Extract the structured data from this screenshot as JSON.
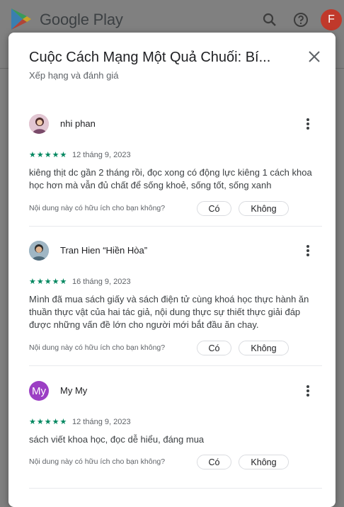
{
  "header": {
    "brand": "Google Play",
    "avatar_letter": "F"
  },
  "dialog": {
    "title": "Cuộc Cách Mạng Một Quả Chuối: Bí...",
    "subtitle": "Xếp hạng và đánh giá"
  },
  "helpful": {
    "question": "Nội dung này có hữu ích cho bạn không?",
    "yes": "Có",
    "no": "Không"
  },
  "reviews": [
    {
      "name": "nhi phan",
      "stars": "★★★★★",
      "date": "12 tháng 9, 2023",
      "text": "kiêng thịt dc gần 2 tháng rồi, đọc xong có động lực kiêng 1 cách khoa học hơn mà vẫn đủ chất để sống khoẻ, sống tốt, sống xanh"
    },
    {
      "name": "Tran Hien “Hiền Hòa”",
      "stars": "★★★★★",
      "date": "16 tháng 9, 2023",
      "text": "Mình đã mua sách giấy và sách điện tử cùng khoá học thực hành ăn thuần thực vật của hai tác giả, nội dung thực sự thiết thực giải đáp được những vấn đề lớn cho người mới bắt đầu ăn chay."
    },
    {
      "name": "My My",
      "avatar_initials": "My",
      "stars": "★★★★★",
      "date": "12 tháng 9, 2023",
      "text": "sách viết khoa học, đọc dễ hiểu, đáng mua"
    }
  ],
  "colors": {
    "star_green": "#01875f",
    "avatar_purple": "#9c3fc4",
    "account_red": "#c0392b"
  }
}
